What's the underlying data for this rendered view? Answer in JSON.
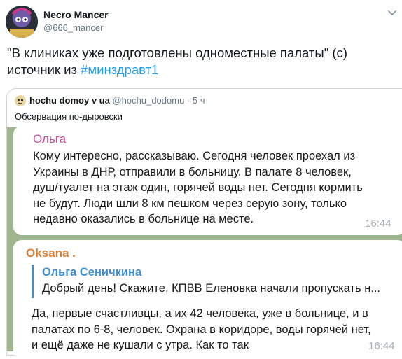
{
  "author": {
    "name": "Necro Mancer",
    "handle": "@666_mancer"
  },
  "tweet": {
    "text_line1": "\"В клиниках уже подготовлены одноместные палаты\" (с)",
    "text_line2_prefix": "источник из ",
    "hashtag": "#минздравт1"
  },
  "quote": {
    "name": "hochu domoy v ua",
    "handle": "@hochu_dodomu",
    "separator": " · ",
    "time": "5 ч",
    "text": "Обсервация по-дыровски"
  },
  "message1": {
    "sender": "Ольга",
    "lines": [
      "Кому интересно, рассказываю. Сегодня человек проехал из",
      "Украины в ДНР, отправили в больницу. В палате 8 человек,",
      "душ/туалет на этаж один, горячей воды нет. Сегодня кормить",
      "не будут. Люди шли 8 км пешком через серую зону, только",
      "недавно оказались в больнице на месте."
    ],
    "time": "16:44"
  },
  "message2": {
    "sender": "Oksana .",
    "reply_name": "Ольга Сеничкина",
    "reply_text": "Добрый день! Скажите, КПВВ Еленовка начали пропускать н...",
    "lines": [
      "Да, первые счастливцы, а их 42 человека, уже в больнице, и в",
      "палатах по 6-8, человек. Охрана в коридоре, воды горячей нет,",
      "и ещё даже не кушали с утра. Как то так"
    ],
    "time": "16:44"
  },
  "icons": {
    "more": "chevron-down-icon",
    "avatar": "avatar-image",
    "quote_avatar": "quote-avatar-image"
  },
  "colors": {
    "hashtag": "#1da1f2",
    "sender1": "#c0509b",
    "sender2": "#d9823b",
    "reply_accent": "#3d8fd1",
    "chat_background": "#9fb58f"
  }
}
